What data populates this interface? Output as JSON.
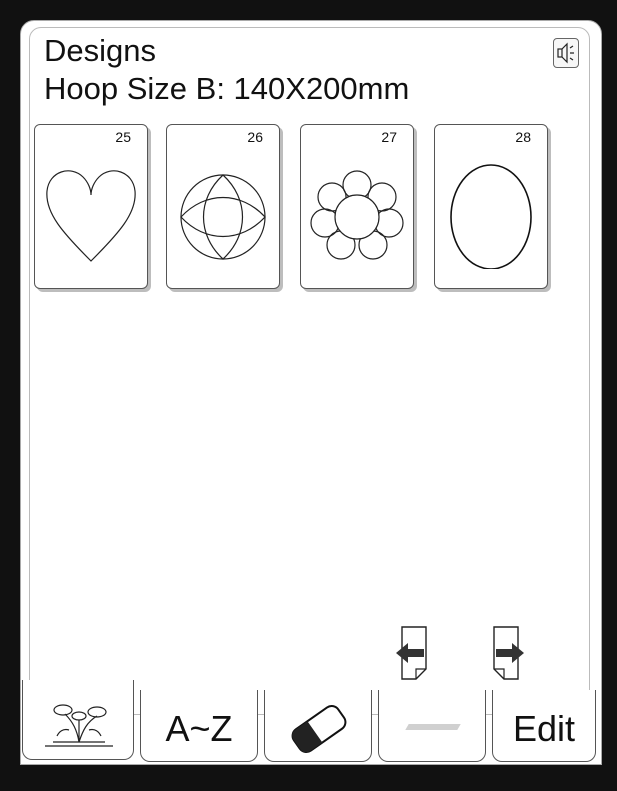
{
  "header": {
    "title": "Designs",
    "hoop_size": "Hoop Size  B: 140X200mm",
    "sound_icon": "speaker-icon"
  },
  "designs": [
    {
      "number": "25",
      "shape": "heart"
    },
    {
      "number": "26",
      "shape": "circle-with-lens"
    },
    {
      "number": "27",
      "shape": "flower"
    },
    {
      "number": "28",
      "shape": "oval"
    }
  ],
  "navigation": {
    "prev_icon": "page-left-arrow-icon",
    "next_icon": "page-right-arrow-icon"
  },
  "tabs": [
    {
      "id": "flowers",
      "label": "",
      "icon": "flower-sprig-icon",
      "active": true
    },
    {
      "id": "alphabet",
      "label": "A~Z",
      "icon": "",
      "active": false
    },
    {
      "id": "eraser",
      "label": "",
      "icon": "eraser-icon",
      "active": false
    },
    {
      "id": "blank",
      "label": "",
      "icon": "",
      "active": false
    },
    {
      "id": "edit",
      "label": "Edit",
      "icon": "",
      "active": false
    }
  ]
}
